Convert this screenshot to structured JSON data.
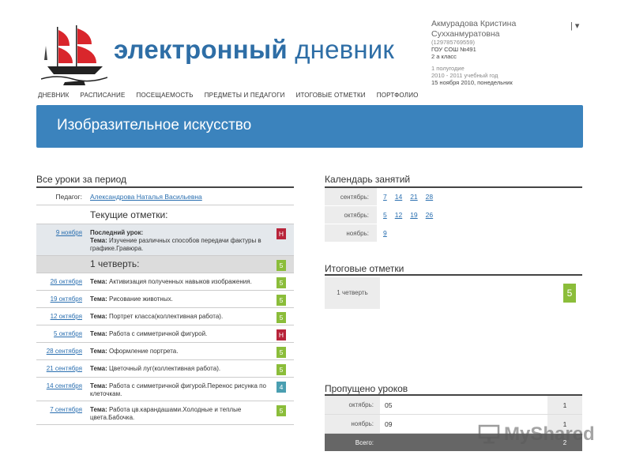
{
  "brand": {
    "part1": "электронный",
    "part2": "дневник"
  },
  "user": {
    "name": "Акмурадова Кристина Сухханмуратовна",
    "id": "(129785769559)",
    "school": "ГОУ СОШ №491",
    "class": "2 а класс",
    "period": "1 полугодие",
    "year": "2010 - 2011 учебный год",
    "date": "15 ноября 2010, понедельник",
    "menu": "| ▾"
  },
  "nav": [
    "ДНЕВНИК",
    "РАСПИСАНИЕ",
    "ПОСЕЩАЕМОСТЬ",
    "ПРЕДМЕТЫ И ПЕДАГОГИ",
    "ИТОГОВЫЕ ОТМЕТКИ",
    "ПОРТФОЛИО"
  ],
  "subject": "Изобразительное искусство",
  "lessons": {
    "title": "Все уроки за период",
    "teacher_label": "Педагог:",
    "teacher": "Александрова Наталья Васильевна",
    "current_title": "Текущие отметки:",
    "last": {
      "date": "9 ноября",
      "label": "Последний урок:",
      "topic_label": "Тема:",
      "topic": "Изучение различных способов передачи фактуры в графике.Гравюра.",
      "mark": "Н"
    },
    "quarter": {
      "label": "1 четверть:",
      "mark": "5"
    },
    "rows": [
      {
        "date": "26 октября",
        "topic_label": "Тема:",
        "topic": "Активизация полученных навыков изображения.",
        "mark": "5"
      },
      {
        "date": "19 октября",
        "topic_label": "Тема:",
        "topic": "Рисование животных.",
        "mark": "5"
      },
      {
        "date": "12 октября",
        "topic_label": "Тема:",
        "topic": "Портрет класса(коллективная работа).",
        "mark": "5"
      },
      {
        "date": "5 октября",
        "topic_label": "Тема:",
        "topic": "Работа с симметричной фигурой.",
        "mark": "Н"
      },
      {
        "date": "28 сентября",
        "topic_label": "Тема:",
        "topic": "Оформление портрета.",
        "mark": "5"
      },
      {
        "date": "21 сентября",
        "topic_label": "Тема:",
        "topic": "Цветочный луг(коллективная работа).",
        "mark": "5"
      },
      {
        "date": "14 сентября",
        "topic_label": "Тема:",
        "topic": "Работа с симметричной фигурой.Перенос рисунка по клеточкам.",
        "mark": "4"
      },
      {
        "date": "7 сентября",
        "topic_label": "Тема:",
        "topic": "Работа цв.карандашами.Холодные и теплые цвета.Бабочка.",
        "mark": "5"
      }
    ]
  },
  "calendar": {
    "title": "Календарь занятий",
    "months": [
      {
        "name": "сентябрь:",
        "days": [
          "7",
          "14",
          "21",
          "28"
        ]
      },
      {
        "name": "октябрь:",
        "days": [
          "5",
          "12",
          "19",
          "26"
        ]
      },
      {
        "name": "ноябрь:",
        "days": [
          "9"
        ]
      }
    ]
  },
  "final": {
    "title": "Итоговые отметки",
    "quarter": "1 четверть",
    "mark": "5"
  },
  "missed": {
    "title": "Пропущено уроков",
    "rows": [
      {
        "month": "октябрь:",
        "value": "05",
        "count": "1"
      },
      {
        "month": "ноябрь:",
        "value": "09",
        "count": "1"
      }
    ],
    "total_label": "Всего:",
    "total": "2"
  },
  "watermark": "MyShared",
  "colors": {
    "banner": "#3b83bd",
    "link": "#2a6fb0",
    "mark_red": "#b8243a",
    "mark_green": "#8bbd3a",
    "mark_teal": "#4a9fb1"
  }
}
